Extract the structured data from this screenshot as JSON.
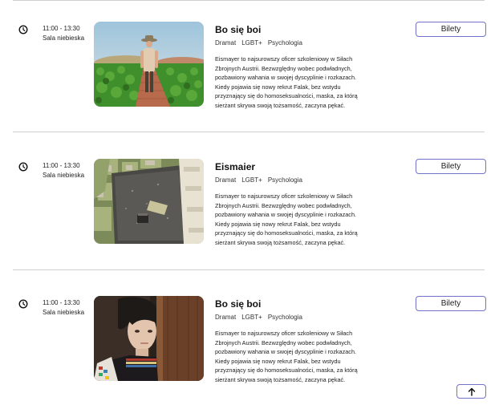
{
  "screenings": [
    {
      "time": "11:00 - 13:30",
      "room": "Sala niebieska",
      "title": "Bo się boi",
      "tags": [
        "Dramat",
        "LGBT+",
        "Psychologia"
      ],
      "description": "Eismayer to najsurowszy oficer szkoleniowy w Siłach Zbrojnych Austrii. Bezwzględny wobec podwładnych, pozbawiony wahania w swojej dyscyplinie i rozkazach. Kiedy pojawia się nowy rekrut Falak, bez wstydu przyznający się do homoseksualności, maska, za którą sierżant skrywa swoją tożsamość, zaczyna pękać.",
      "tickets_label": "Bilety"
    },
    {
      "time": "11:00 - 13:30",
      "room": "Sala niebieska",
      "title": "Eismaier",
      "tags": [
        "Dramat",
        "LGBT+",
        "Psychologia"
      ],
      "description": "Eismayer to najsurowszy oficer szkoleniowy w Siłach Zbrojnych Austrii. Bezwzględny wobec podwładnych, pozbawiony wahania w swojej dyscyplinie i rozkazach. Kiedy pojawia się nowy rekrut Falak, bez wstydu przyznający się do homoseksualności, maska, za którą sierżant skrywa swoją tożsamość, zaczyna pękać.",
      "tickets_label": "Bilety"
    },
    {
      "time": "11:00 - 13:30",
      "room": "Sala niebieska",
      "title": "Bo się boi",
      "tags": [
        "Dramat",
        "LGBT+",
        "Psychologia"
      ],
      "description": "Eismayer to najsurowszy oficer szkoleniowy w Siłach Zbrojnych Austrii. Bezwzględny wobec podwładnych, pozbawiony wahania w swojej dyscyplinie i rozkazach. Kiedy pojawia się nowy rekrut Falak, bez wstydu przyznający się do homoseksualności, maska, za którą sierżant skrywa swoją tożsamość, zaczyna pękać.",
      "tickets_label": "Bilety"
    }
  ],
  "icons": {
    "time": "clock-icon",
    "scroll_top": "arrow-up-icon"
  },
  "colors": {
    "accent_border": "#7173c9",
    "divider": "#cfcfcf"
  }
}
